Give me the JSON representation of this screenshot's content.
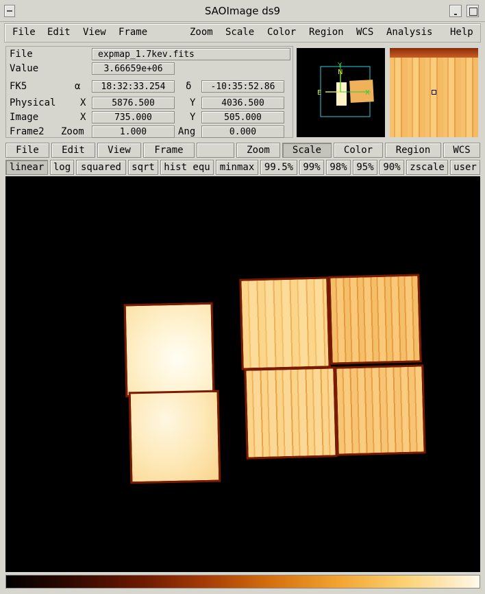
{
  "window": {
    "title": "SAOImage ds9"
  },
  "menubar": [
    "File",
    "Edit",
    "View",
    "Frame",
    "Zoom",
    "Scale",
    "Color",
    "Region",
    "WCS",
    "Analysis",
    "Help"
  ],
  "info": {
    "file_label": "File",
    "file_value": "expmap_1.7kev.fits",
    "value_label": "Value",
    "value_value": "3.66659e+06",
    "fk5_label": "FK5",
    "alpha_sym": "α",
    "alpha_value": "18:32:33.254",
    "delta_sym": "δ",
    "delta_value": "-10:35:52.86",
    "physical_label": "Physical",
    "phys_x_label": "X",
    "phys_x_value": "5876.500",
    "phys_y_label": "Y",
    "phys_y_value": "4036.500",
    "image_label": "Image",
    "img_x_label": "X",
    "img_x_value": "735.000",
    "img_y_label": "Y",
    "img_y_value": "505.000",
    "frame_label": "Frame2",
    "zoom_label": "Zoom",
    "zoom_value": "1.000",
    "ang_label": "Ang",
    "ang_value": "0.000"
  },
  "panner": {
    "north_label": "N",
    "y_label": "Y",
    "east_label": "E",
    "x_label": "X"
  },
  "buttonbar": [
    "File",
    "Edit",
    "View",
    "Frame",
    "",
    "Zoom",
    "Scale",
    "Color",
    "Region",
    "WCS"
  ],
  "scalebar": [
    "linear",
    "log",
    "squared",
    "sqrt",
    "hist equ",
    "minmax",
    "99.5%",
    "99%",
    "98%",
    "95%",
    "90%",
    "zscale",
    "user"
  ],
  "colors": {
    "background": "#d6d6cf",
    "frame": "#000000",
    "chip_bright": "#fff6d8",
    "chip_mid": "#f6c46e"
  }
}
